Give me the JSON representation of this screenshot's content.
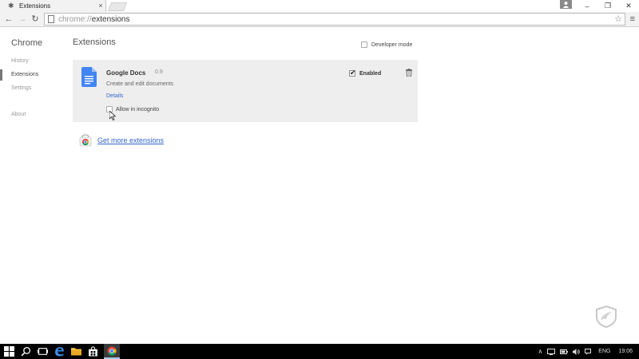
{
  "tab": {
    "title": "Extensions",
    "close": "×"
  },
  "window": {
    "minimize": "–",
    "restore": "❐",
    "close": "✕"
  },
  "toolbar": {
    "back": "←",
    "forward": "→",
    "reload": "↻",
    "url_scheme": "chrome://",
    "url_path": "extensions",
    "star": "☆",
    "menu": "≡"
  },
  "sidebar": {
    "title": "Chrome",
    "items": [
      {
        "label": "History"
      },
      {
        "label": "Extensions"
      },
      {
        "label": "Settings"
      },
      {
        "label": "About"
      }
    ]
  },
  "main": {
    "title": "Extensions",
    "developer_mode_label": "Developer mode",
    "extension": {
      "name": "Google Docs",
      "version": "0.9",
      "description": "Create and edit documents",
      "details_link": "Details",
      "incognito_label": "Allow in incognito",
      "enabled_label": "Enabled",
      "enabled_check": "✔"
    },
    "get_more_link": "Get more extensions"
  },
  "taskbar": {
    "language": "ENG",
    "time": "19:06"
  },
  "colors": {
    "link": "#3366cc",
    "card_bg": "#eeeeee",
    "docs_blue": "#4285f4"
  }
}
